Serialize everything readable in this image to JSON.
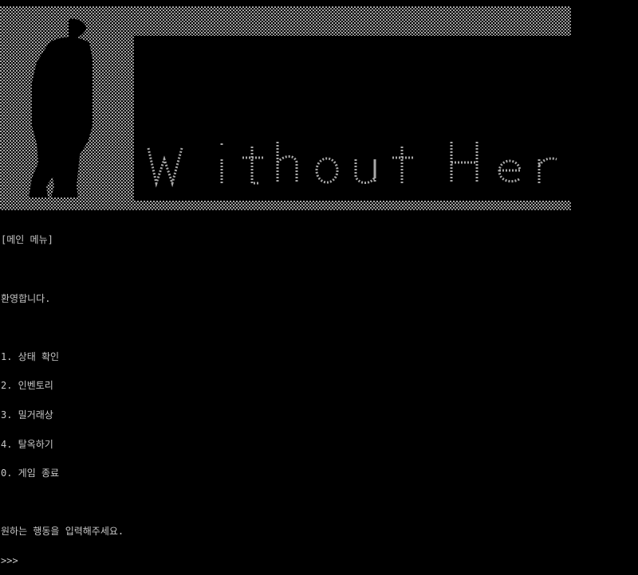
{
  "banner": {
    "title_word_1": "Without",
    "title_word_2": "Her"
  },
  "menu": {
    "header": "[메인 메뉴]",
    "welcome": "환영합니다.",
    "items": [
      "1. 상태 확인",
      "2. 인벤토리",
      "3. 밀거래상",
      "4. 탈옥하기",
      "0. 게임 종료"
    ],
    "instruction": "원하는 행동을 입력해주세요.",
    "prompt": ">>>"
  },
  "colors": {
    "background": "#000000",
    "text": "#c7c7c7",
    "ascii_fill": "#9a9a9a"
  }
}
